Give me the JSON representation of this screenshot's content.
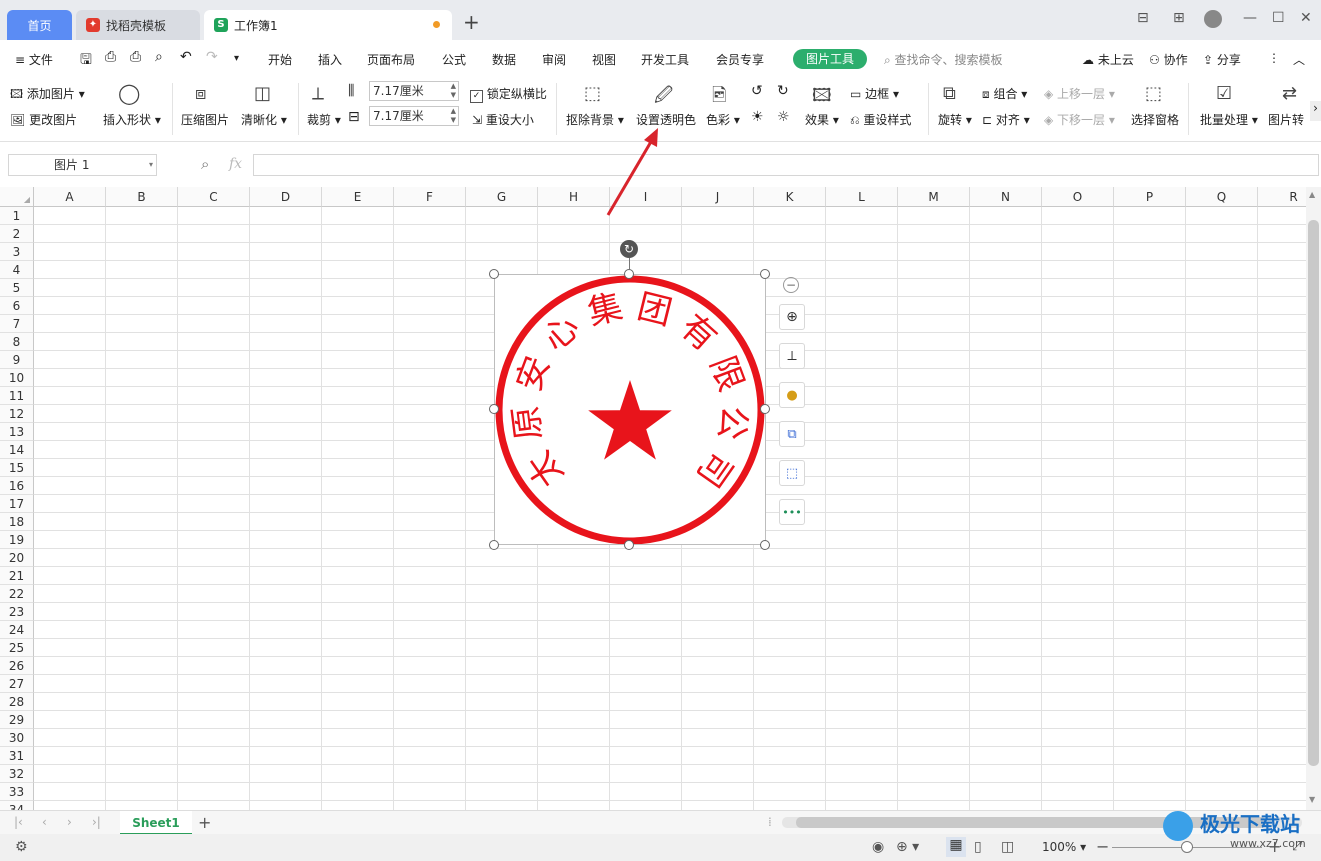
{
  "tabs": {
    "home": "首页",
    "daoke": "找稻壳模板",
    "workbook": "工作簿1",
    "add": "+"
  },
  "menu": {
    "file": "文件",
    "items": [
      "开始",
      "插入",
      "页面布局",
      "公式",
      "数据",
      "审阅",
      "视图",
      "开发工具",
      "会员专享"
    ],
    "picture_tools": "图片工具",
    "search_placeholder": "查找命令、搜索模板",
    "cloud": "未上云",
    "collab": "协作",
    "share": "分享"
  },
  "ribbon": {
    "add_picture": "添加图片",
    "change_picture": "更改图片",
    "insert_shape": "插入形状",
    "compress": "压缩图片",
    "sharpen": "清晰化",
    "crop": "裁剪",
    "height_value": "7.17厘米",
    "width_value": "7.17厘米",
    "lock_ratio": "锁定纵横比",
    "reset_size": "重设大小",
    "remove_bg": "抠除背景",
    "set_transparent": "设置透明色",
    "color": "色彩",
    "effect": "效果",
    "border": "边框",
    "reset_style": "重设样式",
    "rotate": "旋转",
    "group": "组合",
    "align": "对齐",
    "bring_forward": "上移一层",
    "send_backward": "下移一层",
    "selection_pane": "选择窗格",
    "batch": "批量处理",
    "convert": "图片转"
  },
  "formula": {
    "namebox": "图片 1",
    "fx": "fx"
  },
  "grid": {
    "columns": [
      "A",
      "B",
      "C",
      "D",
      "E",
      "F",
      "G",
      "H",
      "I",
      "J",
      "K",
      "L",
      "M",
      "N",
      "O",
      "P",
      "Q",
      "R"
    ],
    "rows": [
      "1",
      "2",
      "3",
      "4",
      "5",
      "6",
      "7",
      "8",
      "9",
      "10",
      "11",
      "12",
      "13",
      "14",
      "15",
      "16",
      "17",
      "18",
      "19",
      "20",
      "21",
      "22",
      "23",
      "24",
      "25",
      "26",
      "27",
      "28",
      "29",
      "30",
      "31",
      "32",
      "33",
      "34"
    ]
  },
  "stamp": {
    "text_chars": [
      "太",
      "原",
      "安",
      "心",
      "集",
      "团",
      "有",
      "限",
      "公",
      "司"
    ],
    "color": "#e8141b"
  },
  "sheets": {
    "active": "Sheet1",
    "add": "+"
  },
  "status": {
    "zoom": "100%"
  },
  "watermark": {
    "text": "极光下载站",
    "url": "www.xz7.com"
  }
}
